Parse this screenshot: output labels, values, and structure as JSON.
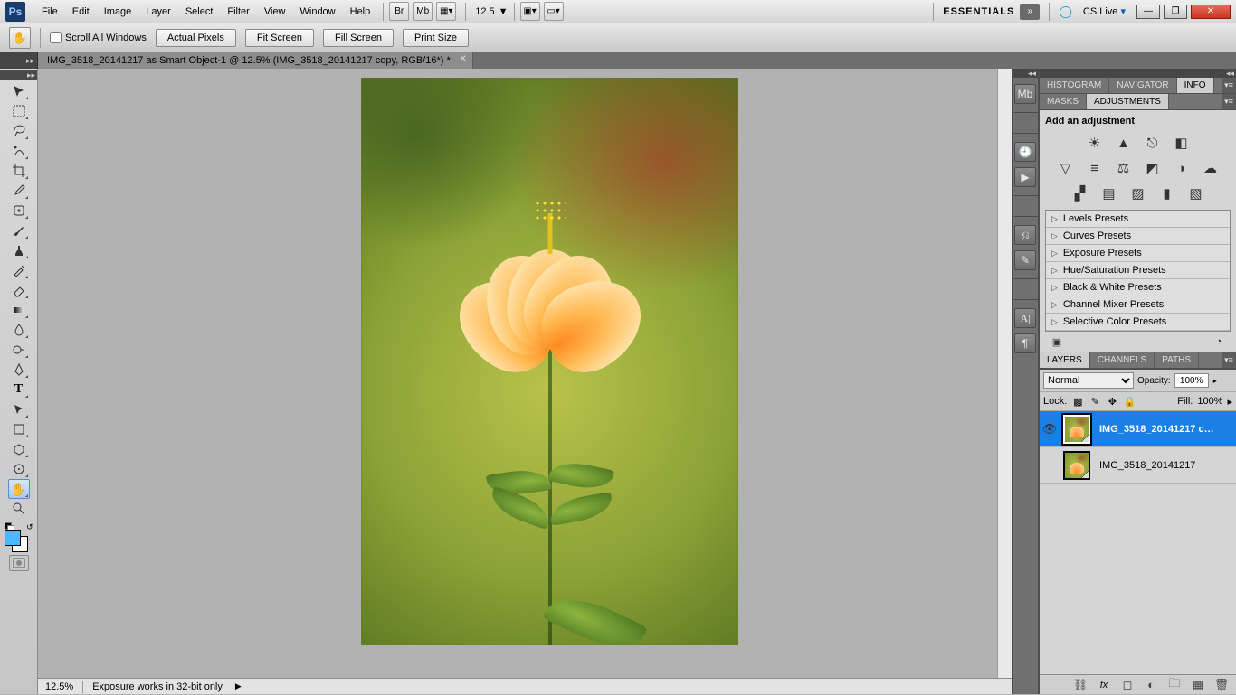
{
  "app_abbrev": "Ps",
  "menu": [
    "File",
    "Edit",
    "Image",
    "Layer",
    "Select",
    "Filter",
    "View",
    "Window",
    "Help"
  ],
  "menubar_icons": [
    "Br",
    "Mb"
  ],
  "zoom_level": "12.5",
  "workspace_label": "ESSENTIALS",
  "cslive_label": "CS Live",
  "optionbar": {
    "scroll_all_label": "Scroll All Windows",
    "buttons": [
      "Actual Pixels",
      "Fit Screen",
      "Fill Screen",
      "Print Size"
    ]
  },
  "document_tab": "IMG_3518_20141217 as Smart Object-1 @ 12.5% (IMG_3518_20141217 copy, RGB/16*) *",
  "status": {
    "zoom": "12.5%",
    "text": "Exposure works in 32-bit only"
  },
  "right_tabs_top": [
    "HISTOGRAM",
    "NAVIGATOR",
    "INFO"
  ],
  "right_tabs_adj": [
    "MASKS",
    "ADJUSTMENTS"
  ],
  "adjustments": {
    "title": "Add an adjustment",
    "presets": [
      "Levels Presets",
      "Curves Presets",
      "Exposure Presets",
      "Hue/Saturation Presets",
      "Black & White Presets",
      "Channel Mixer Presets",
      "Selective Color Presets"
    ]
  },
  "right_tabs_layers": [
    "LAYERS",
    "CHANNELS",
    "PATHS"
  ],
  "layers_panel": {
    "blend_mode": "Normal",
    "opacity_label": "Opacity:",
    "opacity_value": "100%",
    "lock_label": "Lock:",
    "fill_label": "Fill:",
    "fill_value": "100%",
    "layers": [
      {
        "name": "IMG_3518_20141217 c…",
        "visible": true,
        "selected": true,
        "smart": true
      },
      {
        "name": "IMG_3518_20141217",
        "visible": false,
        "selected": false,
        "smart": true
      }
    ]
  }
}
